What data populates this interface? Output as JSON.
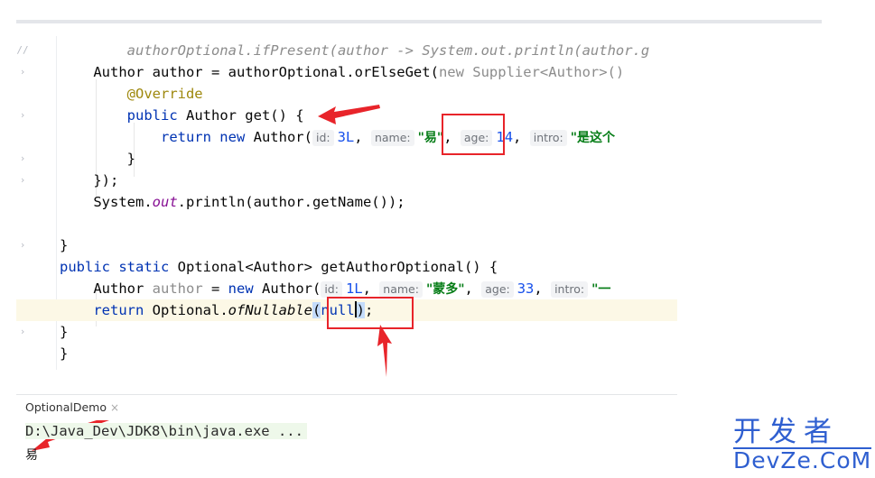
{
  "editor": {
    "lines": [
      {
        "mark": "//",
        "parts": [
          {
            "t": "        authorOptional.ifPresent(author -> System.out.println(author.g",
            "c": "cmt"
          }
        ]
      },
      {
        "mark": "›",
        "parts": [
          {
            "t": "    Author author = authorOptional.orElseGet(",
            "c": ""
          },
          {
            "t": "new",
            "c": "grey"
          },
          {
            "t": " Supplier<Author>()",
            "c": "grey"
          }
        ]
      },
      {
        "mark": "",
        "parts": [
          {
            "t": "        ",
            "c": ""
          },
          {
            "t": "@Override",
            "c": "ann"
          }
        ]
      },
      {
        "mark": "›",
        "parts": [
          {
            "t": "        ",
            "c": ""
          },
          {
            "t": "public",
            "c": "kw"
          },
          {
            "t": " Author get() {",
            "c": ""
          }
        ]
      },
      {
        "mark": "",
        "parts": [
          {
            "t": "            ",
            "c": ""
          },
          {
            "t": "return new",
            "c": "kw"
          },
          {
            "t": " Author(",
            "c": ""
          },
          {
            "hint": "id:"
          },
          {
            "t": "3L",
            "c": "num"
          },
          {
            "t": ", ",
            "c": ""
          },
          {
            "hint": "name:"
          },
          {
            "t": "\"易\"",
            "c": "str"
          },
          {
            "t": ", ",
            "c": ""
          },
          {
            "hint": "age:"
          },
          {
            "t": "14",
            "c": "num"
          },
          {
            "t": ", ",
            "c": ""
          },
          {
            "hint": "intro:"
          },
          {
            "t": "\"是这个",
            "c": "str"
          }
        ]
      },
      {
        "mark": "›",
        "parts": [
          {
            "t": "        }",
            "c": ""
          }
        ]
      },
      {
        "mark": "›",
        "parts": [
          {
            "t": "    });",
            "c": ""
          }
        ]
      },
      {
        "mark": "",
        "parts": [
          {
            "t": "    System.",
            "c": ""
          },
          {
            "t": "out",
            "c": "field"
          },
          {
            "t": ".println(author.getName());",
            "c": ""
          }
        ]
      },
      {
        "mark": "",
        "parts": []
      },
      {
        "mark": "›",
        "parts": [
          {
            "t": "}",
            "c": ""
          }
        ]
      },
      {
        "mark": "",
        "parts": [
          {
            "t": "public static",
            "c": "kw"
          },
          {
            "t": " Optional<Author> getAuthorOptional() {",
            "c": ""
          }
        ]
      },
      {
        "mark": "",
        "parts": [
          {
            "t": "    Author ",
            "c": ""
          },
          {
            "t": "author",
            "c": "grey"
          },
          {
            "t": " = ",
            "c": ""
          },
          {
            "t": "new",
            "c": "kw"
          },
          {
            "t": " Author(",
            "c": ""
          },
          {
            "hint": "id:"
          },
          {
            "t": "1L",
            "c": "num"
          },
          {
            "t": ", ",
            "c": ""
          },
          {
            "hint": "name:"
          },
          {
            "t": "\"蒙多\"",
            "c": "str"
          },
          {
            "t": ", ",
            "c": ""
          },
          {
            "hint": "age:"
          },
          {
            "t": "33",
            "c": "num"
          },
          {
            "t": ", ",
            "c": ""
          },
          {
            "hint": "intro:"
          },
          {
            "t": "\"一",
            "c": "str"
          }
        ]
      },
      {
        "mark": "",
        "current": true,
        "parts": [
          {
            "t": "    ",
            "c": ""
          },
          {
            "t": "return",
            "c": "kw"
          },
          {
            "t": " Optional.",
            "c": ""
          },
          {
            "t": "ofNullable",
            "c": "it"
          },
          {
            "t": "(",
            "c": "bracket-hl"
          },
          {
            "t": "null",
            "c": "kw"
          },
          {
            "caret": true
          },
          {
            "t": ")",
            "c": "bracket-hl"
          },
          {
            "t": ";",
            "c": ""
          }
        ]
      },
      {
        "mark": "›",
        "parts": [
          {
            "t": "}",
            "c": ""
          }
        ]
      },
      {
        "mark": "",
        "parts": [
          {
            "t": "}",
            "c": ""
          }
        ]
      }
    ]
  },
  "console": {
    "tab_label": "OptionalDemo",
    "close_glyph": "×",
    "command": "D:\\Java_Dev\\JDK8\\bin\\java.exe ...",
    "output": "易"
  },
  "watermark": {
    "cn": "开发者",
    "en": "DevZe.CoM"
  },
  "colors": {
    "keyword": "#0033b3",
    "string": "#067d17",
    "number": "#1750eb",
    "annotation": "#9e880d",
    "highlight_box": "#e8242a",
    "watermark": "#2f5fd0"
  }
}
